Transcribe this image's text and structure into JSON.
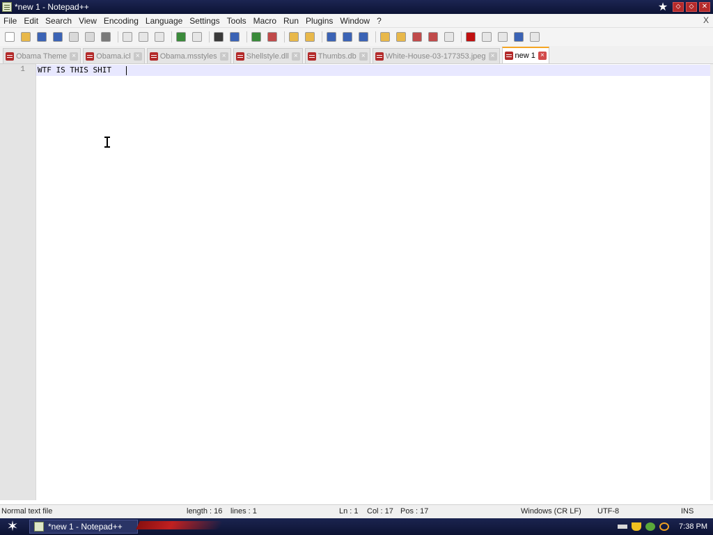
{
  "window": {
    "title": "*new 1 - Notepad++",
    "star_glyph": "★",
    "controls": [
      "⬦",
      "⬦",
      "✕"
    ]
  },
  "menu": {
    "items": [
      "File",
      "Edit",
      "Search",
      "View",
      "Encoding",
      "Language",
      "Settings",
      "Tools",
      "Macro",
      "Run",
      "Plugins",
      "Window",
      "?"
    ],
    "close_label": "X"
  },
  "toolbar": {
    "icons": [
      {
        "name": "new-file-icon",
        "color": "#ffffff"
      },
      {
        "name": "open-file-icon",
        "color": "#e8b84a"
      },
      {
        "name": "save-icon",
        "color": "#3b63b5"
      },
      {
        "name": "save-all-icon",
        "color": "#3b63b5"
      },
      {
        "name": "close-icon",
        "color": "#d9d9d9"
      },
      {
        "name": "close-all-icon",
        "color": "#d9d9d9"
      },
      {
        "name": "print-icon",
        "color": "#7a7a7a"
      },
      {
        "name": "cut-icon",
        "color": "#e6e6e6"
      },
      {
        "name": "copy-icon",
        "color": "#e6e6e6"
      },
      {
        "name": "paste-icon",
        "color": "#e6e6e6"
      },
      {
        "name": "undo-icon",
        "color": "#3a8a3a"
      },
      {
        "name": "redo-icon",
        "color": "#e6e6e6"
      },
      {
        "name": "find-icon",
        "color": "#3a3a3a"
      },
      {
        "name": "replace-icon",
        "color": "#3b63b5"
      },
      {
        "name": "zoom-in-icon",
        "color": "#3a8a3a"
      },
      {
        "name": "zoom-out-icon",
        "color": "#c04a4a"
      },
      {
        "name": "sync-vertical-icon",
        "color": "#e8b84a"
      },
      {
        "name": "sync-horizontal-icon",
        "color": "#e8b84a"
      },
      {
        "name": "word-wrap-icon",
        "color": "#3b63b5"
      },
      {
        "name": "show-all-characters-icon",
        "color": "#3b63b5"
      },
      {
        "name": "indent-guide-icon",
        "color": "#3b63b5"
      },
      {
        "name": "folder-view-icon",
        "color": "#e8b84a"
      },
      {
        "name": "document-map-icon",
        "color": "#e8b84a"
      },
      {
        "name": "function-list-icon",
        "color": "#c04a4a"
      },
      {
        "name": "monitoring-icon",
        "color": "#c04a4a"
      },
      {
        "name": "comment-icon",
        "color": "#e6e6e6"
      },
      {
        "name": "record-macro-icon",
        "color": "#c01010"
      },
      {
        "name": "stop-macro-icon",
        "color": "#e6e6e6"
      },
      {
        "name": "play-macro-icon",
        "color": "#e6e6e6"
      },
      {
        "name": "run-macro-multiple-icon",
        "color": "#3b63b5"
      },
      {
        "name": "save-macro-icon",
        "color": "#e6e6e6"
      }
    ]
  },
  "tabs": [
    {
      "label": "Obama Theme",
      "active": false
    },
    {
      "label": "Obama.icl",
      "active": false
    },
    {
      "label": "Obama.msstyles",
      "active": false
    },
    {
      "label": "Shellstyle.dll",
      "active": false
    },
    {
      "label": "Thumbs.db",
      "active": false
    },
    {
      "label": "White-House-03-177353.jpeg",
      "active": false
    },
    {
      "label": "new 1",
      "active": true
    }
  ],
  "editor": {
    "line_number": "1",
    "text": "WTF IS THIS SHIT"
  },
  "status": {
    "file_type": "Normal text file",
    "length": "length : 16",
    "lines": "lines : 1",
    "ln": "Ln : 1",
    "col": "Col : 17",
    "pos": "Pos : 17",
    "eol": "Windows (CR LF)",
    "encoding": "UTF-8",
    "mode": "INS"
  },
  "taskbar": {
    "start_glyph": "✶",
    "task_label": "*new 1 - Notepad++",
    "clock": "7:38 PM"
  }
}
